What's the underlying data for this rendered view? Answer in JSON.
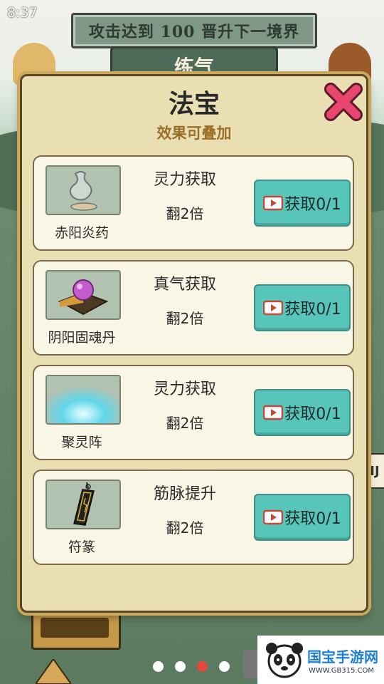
{
  "status_bar": {
    "time": "8:37"
  },
  "game": {
    "banner_text": "攻击达到 100 晋升下一境界",
    "realm": "练气",
    "side_tab": "IJ"
  },
  "modal": {
    "title": "法宝",
    "subtitle": "效果可叠加",
    "items": [
      {
        "name": "赤阳炎药",
        "effect": "灵力获取",
        "multiplier": "翻2倍",
        "button": "获取0/1",
        "icon": "elixir-bottle-icon"
      },
      {
        "name": "阴阳固魂丹",
        "effect": "真气获取",
        "multiplier": "翻2倍",
        "button": "获取0/1",
        "icon": "purple-pill-icon"
      },
      {
        "name": "聚灵阵",
        "effect": "灵力获取",
        "multiplier": "翻2倍",
        "button": "获取0/1",
        "icon": "spirit-array-icon"
      },
      {
        "name": "符篆",
        "effect": "筋脉提升",
        "multiplier": "翻2倍",
        "button": "获取0/1",
        "icon": "talisman-icon"
      }
    ]
  },
  "pager": {
    "count": 4,
    "active_index": 2
  },
  "watermark": {
    "brand": "国宝手游网",
    "url": "WWW.GB315.COM"
  },
  "colors": {
    "button_teal": "#57c5ba",
    "video_icon_red": "#c4473a",
    "close_pink": "#e9466f",
    "subtitle_brown": "#9b6f2a"
  }
}
